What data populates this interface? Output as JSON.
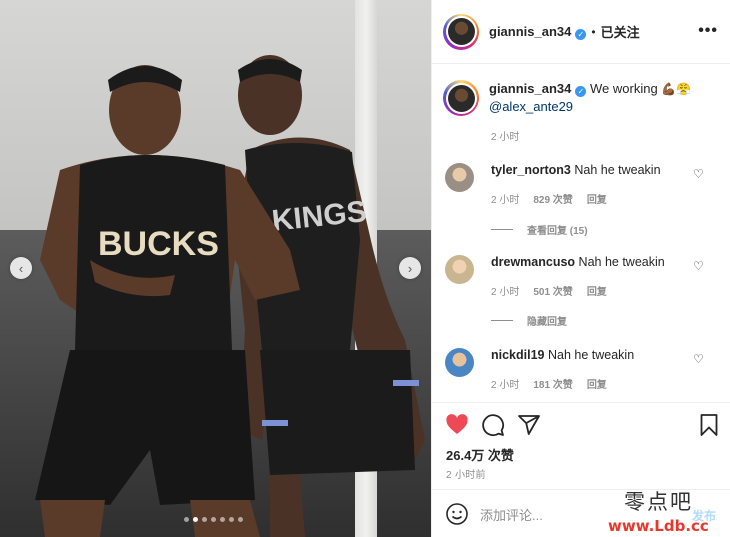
{
  "post": {
    "username": "giannis_an34",
    "follow_status": "已关注",
    "more": "•••",
    "caption_text": "We working",
    "caption_emojis": "💪🏾😤",
    "caption_mention": "@alex_ante29",
    "caption_time": "2 小时",
    "likes": "26.4万 次赞",
    "posted": "2 小时前"
  },
  "comments": [
    {
      "user": "tyler_norton3",
      "text": "Nah he tweakin",
      "time": "2 小时",
      "likes": "829 次赞",
      "reply": "回复",
      "replies_toggle": "查看回复 (15)"
    },
    {
      "user": "drewmancuso",
      "text": "Nah he tweakin",
      "time": "2 小时",
      "likes": "501 次赞",
      "reply": "回复",
      "replies_toggle": "隐藏回复"
    },
    {
      "user": "nickdil19",
      "text": "Nah he tweakin",
      "time": "2 小时",
      "likes": "181 次赞",
      "reply": "回复"
    }
  ],
  "comment_box": {
    "placeholder": "添加评论...",
    "post_label": "发布"
  },
  "photo": {
    "slide_count": 7,
    "active_slide": 2,
    "jersey_left": "BUCKS",
    "jersey_right": "KINGS"
  },
  "watermark": {
    "line1": "零点吧",
    "line2": "www.Ldb.cc"
  },
  "colors": {
    "like_red": "#ed4956",
    "link_blue": "#00376b",
    "verified_blue": "#3897f0",
    "muted": "#8e8e8e"
  }
}
